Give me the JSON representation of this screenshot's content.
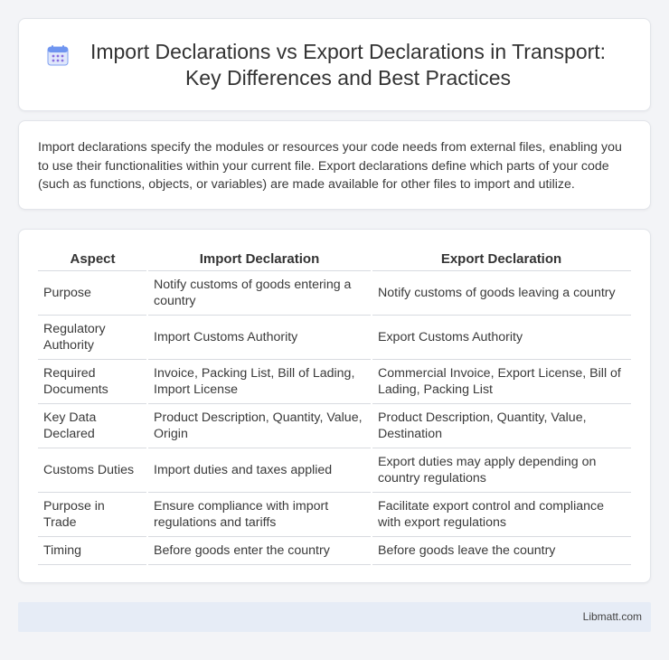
{
  "header": {
    "icon": "calendar-icon",
    "title": "Import Declarations vs Export Declarations in Transport: Key Differences and Best Practices"
  },
  "intro": {
    "text": "Import declarations specify the modules or resources your code needs from external files, enabling you to use their functionalities within your current file. Export declarations define which parts of your code (such as functions, objects, or variables) are made available for other files to import and utilize."
  },
  "table": {
    "headers": [
      "Aspect",
      "Import Declaration",
      "Export Declaration"
    ],
    "rows": [
      [
        "Purpose",
        "Notify customs of goods entering a country",
        "Notify customs of goods leaving a country"
      ],
      [
        "Regulatory Authority",
        "Import Customs Authority",
        "Export Customs Authority"
      ],
      [
        "Required Documents",
        "Invoice, Packing List, Bill of Lading, Import License",
        "Commercial Invoice, Export License, Bill of Lading, Packing List"
      ],
      [
        "Key Data Declared",
        "Product Description, Quantity, Value, Origin",
        "Product Description, Quantity, Value, Destination"
      ],
      [
        "Customs Duties",
        "Import duties and taxes applied",
        "Export duties may apply depending on country regulations"
      ],
      [
        "Purpose in Trade",
        "Ensure compliance with import regulations and tariffs",
        "Facilitate export control and compliance with export regulations"
      ],
      [
        "Timing",
        "Before goods enter the country",
        "Before goods leave the country"
      ]
    ]
  },
  "footer": {
    "brand": "Libmatt.com"
  },
  "colors": {
    "page_bg": "#f3f4f7",
    "card_bg": "#ffffff",
    "footer_bg": "#e6ecf6",
    "icon_accent": "#5b8def"
  }
}
